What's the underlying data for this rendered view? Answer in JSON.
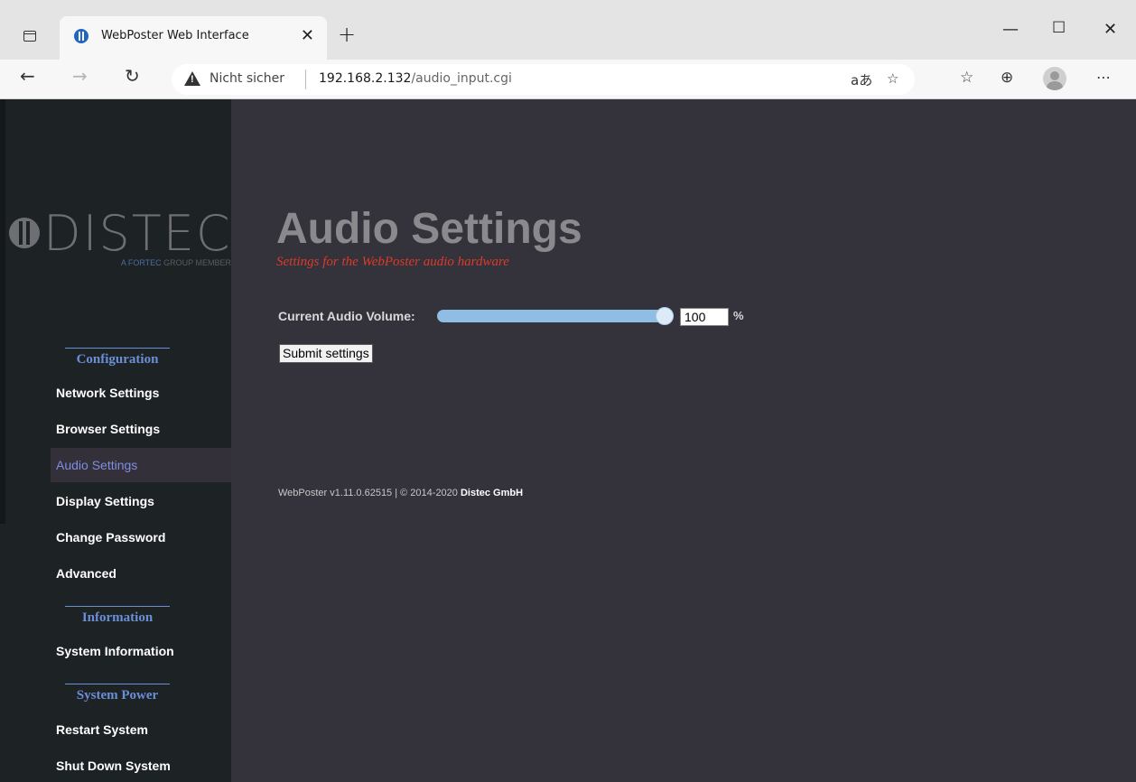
{
  "browser": {
    "tab_title": "WebPoster Web Interface",
    "security_label": "Nicht sicher",
    "url_host": "192.168.2.132",
    "url_path": "/audio_input.cgi"
  },
  "sidebar": {
    "logo_text": "DISTEC",
    "logo_sub_highlight": "A FORTEC",
    "logo_sub_rest": " GROUP MEMBER",
    "sections": {
      "configuration": "Configuration",
      "information": "Information",
      "system_power": "System Power"
    },
    "items": {
      "network": "Network Settings",
      "browser": "Browser Settings",
      "audio": "Audio Settings",
      "display": "Display Settings",
      "password": "Change Password",
      "advanced": "Advanced",
      "sysinfo": "System Information",
      "restart": "Restart System",
      "shutdown": "Shut Down System"
    }
  },
  "main": {
    "title": "Audio Settings",
    "subtitle": "Settings for the WebPoster audio hardware",
    "volume_label": "Current Audio Volume:",
    "volume_value": "100",
    "volume_fraction": 1.0,
    "volume_unit": "%",
    "submit_label": "Submit settings"
  },
  "footer": {
    "text": "WebPoster v1.11.0.62515 | © 2014-2020 ",
    "company": "Distec GmbH"
  },
  "colors": {
    "sidebar_bg": "#1d2225",
    "content_bg": "#34323a",
    "section_heading": "#6b8fd6",
    "active_item": "#7e8ee0",
    "subtitle": "#dd3a2a",
    "slider_fill": "#8fbde3"
  }
}
